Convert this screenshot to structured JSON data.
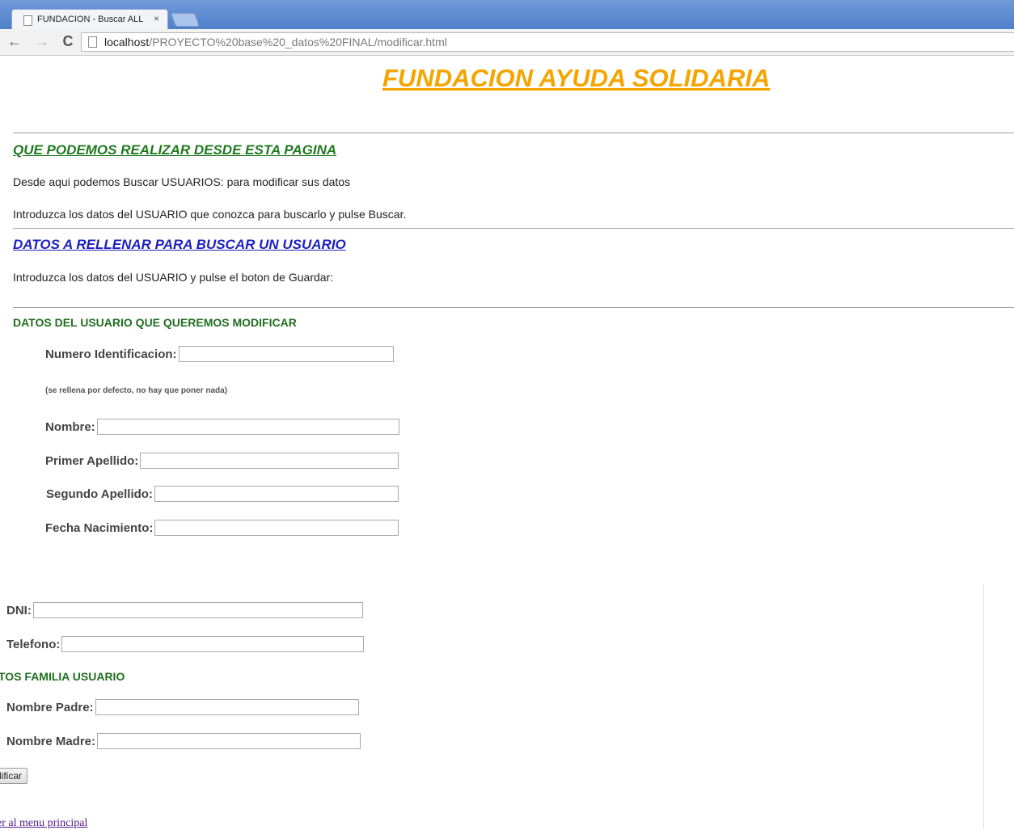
{
  "browser": {
    "tab_title": "FUNDACION - Buscar ALL",
    "tab_close": "×",
    "url_host": "localhost",
    "url_path": "/PROYECTO%20base%20_datos%20FINAL/modificar.html",
    "back": "←",
    "forward": "→",
    "reload": "C"
  },
  "page": {
    "title": "FUNDACION AYUDA SOLIDARIA",
    "section1_heading": "QUE PODEMOS REALIZAR DESDE ESTA PAGINA",
    "para1": "Desde aqui podemos Buscar USUARIOS: para modificar sus datos",
    "para2": "Introduzca los datos del USUARIO que conozca para buscarlo y pulse Buscar.",
    "section2_heading": "DATOS A RELLENAR PARA BUSCAR UN USUARIO",
    "para3": "Introduzca los datos del USUARIO y pulse el boton de Guardar:",
    "form_heading": "DATOS DEL USUARIO QUE QUEREMOS MODIFICAR",
    "family_heading": "TOS FAMILIA USUARIO",
    "note": "(se rellena por defecto, no hay que poner nada)",
    "fields": {
      "id_label": "Numero Identificacion:",
      "nombre_label": "Nombre:",
      "apellido1_label": "Primer Apellido:",
      "apellido2_label": "Segundo Apellido:",
      "fecha_label": "Fecha Nacimiento:",
      "dni_label": "DNI:",
      "telefono_label": "Telefono:",
      "padre_label": "Nombre Padre:",
      "madre_label": "Nombre Madre:"
    },
    "submit_label": "dificar",
    "back_link": "er al menu principal"
  }
}
